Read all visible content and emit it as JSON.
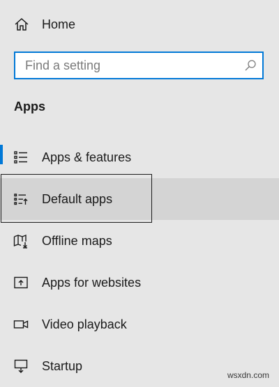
{
  "home": {
    "label": "Home",
    "icon": "home-icon"
  },
  "search": {
    "placeholder": "Find a setting",
    "value": "",
    "icon": "search-icon"
  },
  "section": {
    "title": "Apps"
  },
  "nav": {
    "items": [
      {
        "label": "Apps & features",
        "icon": "apps-features-icon",
        "state": "selected"
      },
      {
        "label": "Default apps",
        "icon": "default-apps-icon",
        "state": "hover-focus"
      },
      {
        "label": "Offline maps",
        "icon": "offline-maps-icon",
        "state": "normal"
      },
      {
        "label": "Apps for websites",
        "icon": "apps-for-websites-icon",
        "state": "normal"
      },
      {
        "label": "Video playback",
        "icon": "video-playback-icon",
        "state": "normal"
      },
      {
        "label": "Startup",
        "icon": "startup-icon",
        "state": "normal"
      }
    ]
  },
  "colors": {
    "accent": "#0078d7",
    "background": "#e6e6e6",
    "hover": "#d4d4d4"
  },
  "watermark": {
    "text": "wsxdn.com"
  }
}
